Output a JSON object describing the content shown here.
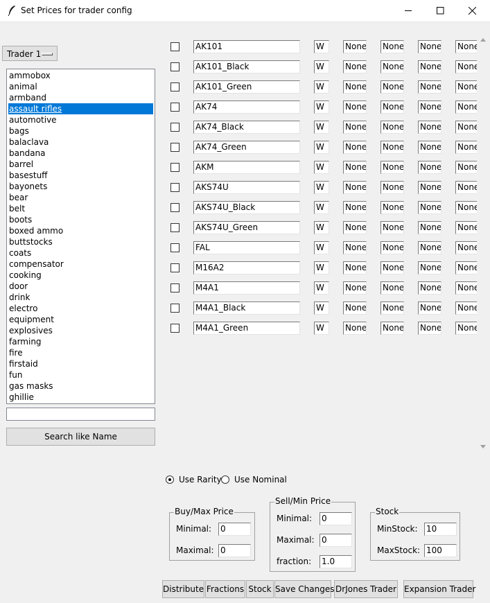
{
  "window": {
    "title": "Set Prices for trader config",
    "icon": "feather-icon",
    "controls": [
      "minimize-icon",
      "maximize-icon",
      "close-icon"
    ]
  },
  "trader_menu": {
    "label": "Trader 1"
  },
  "categories": {
    "selected": "assault rifles",
    "items": [
      "ammobox",
      "animal",
      "armband",
      "assault rifles",
      "automotive",
      "bags",
      "balaclava",
      "bandana",
      "barrel",
      "basestuff",
      "bayonets",
      "bear",
      "belt",
      "boots",
      "boxed ammo",
      "buttstocks",
      "coats",
      "compensator",
      "cooking",
      "door",
      "drink",
      "electro",
      "equipment",
      "explosives",
      "farming",
      "fire",
      "firstaid",
      "fun",
      "gas masks",
      "ghillie"
    ]
  },
  "search": {
    "value": "",
    "button_label": "Search like Name"
  },
  "items": [
    {
      "name": "AK101",
      "type": "W",
      "v0": "None",
      "v1": "None",
      "v2": "None",
      "v3": "None"
    },
    {
      "name": "AK101_Black",
      "type": "W",
      "v0": "None",
      "v1": "None",
      "v2": "None",
      "v3": "None"
    },
    {
      "name": "AK101_Green",
      "type": "W",
      "v0": "None",
      "v1": "None",
      "v2": "None",
      "v3": "None"
    },
    {
      "name": "AK74",
      "type": "W",
      "v0": "None",
      "v1": "None",
      "v2": "None",
      "v3": "None"
    },
    {
      "name": "AK74_Black",
      "type": "W",
      "v0": "None",
      "v1": "None",
      "v2": "None",
      "v3": "None"
    },
    {
      "name": "AK74_Green",
      "type": "W",
      "v0": "None",
      "v1": "None",
      "v2": "None",
      "v3": "None"
    },
    {
      "name": "AKM",
      "type": "W",
      "v0": "None",
      "v1": "None",
      "v2": "None",
      "v3": "None"
    },
    {
      "name": "AKS74U",
      "type": "W",
      "v0": "None",
      "v1": "None",
      "v2": "None",
      "v3": "None"
    },
    {
      "name": "AKS74U_Black",
      "type": "W",
      "v0": "None",
      "v1": "None",
      "v2": "None",
      "v3": "None"
    },
    {
      "name": "AKS74U_Green",
      "type": "W",
      "v0": "None",
      "v1": "None",
      "v2": "None",
      "v3": "None"
    },
    {
      "name": "FAL",
      "type": "W",
      "v0": "None",
      "v1": "None",
      "v2": "None",
      "v3": "None"
    },
    {
      "name": "M16A2",
      "type": "W",
      "v0": "None",
      "v1": "None",
      "v2": "None",
      "v3": "None"
    },
    {
      "name": "M4A1",
      "type": "W",
      "v0": "None",
      "v1": "None",
      "v2": "None",
      "v3": "None"
    },
    {
      "name": "M4A1_Black",
      "type": "W",
      "v0": "None",
      "v1": "None",
      "v2": "None",
      "v3": "None"
    },
    {
      "name": "M4A1_Green",
      "type": "W",
      "v0": "None",
      "v1": "None",
      "v2": "None",
      "v3": "None"
    }
  ],
  "mode": {
    "selected": "Use Rarity",
    "rarity_label": "Use Rarity",
    "nominal_label": "Use Nominal"
  },
  "buy_price": {
    "title": "Buy/Max Price",
    "minimal_label": "Minimal:",
    "minimal_value": "0",
    "maximal_label": "Maximal:",
    "maximal_value": "0"
  },
  "sell_price": {
    "title": "Sell/Min Price",
    "minimal_label": "Minimal:",
    "minimal_value": "0",
    "maximal_label": "Maximal:",
    "maximal_value": "0",
    "fraction_label": "fraction:",
    "fraction_value": "1.0"
  },
  "stock": {
    "title": "Stock",
    "min_label": "MinStock:",
    "min_value": "10",
    "max_label": "MaxStock:",
    "max_value": "100"
  },
  "actions": {
    "distribute": "Distribute",
    "fractions": "Fractions",
    "stock": "Stock",
    "save": "Save Changes",
    "drjones": "DrJones Trader",
    "expansion": "Expansion Trader"
  }
}
